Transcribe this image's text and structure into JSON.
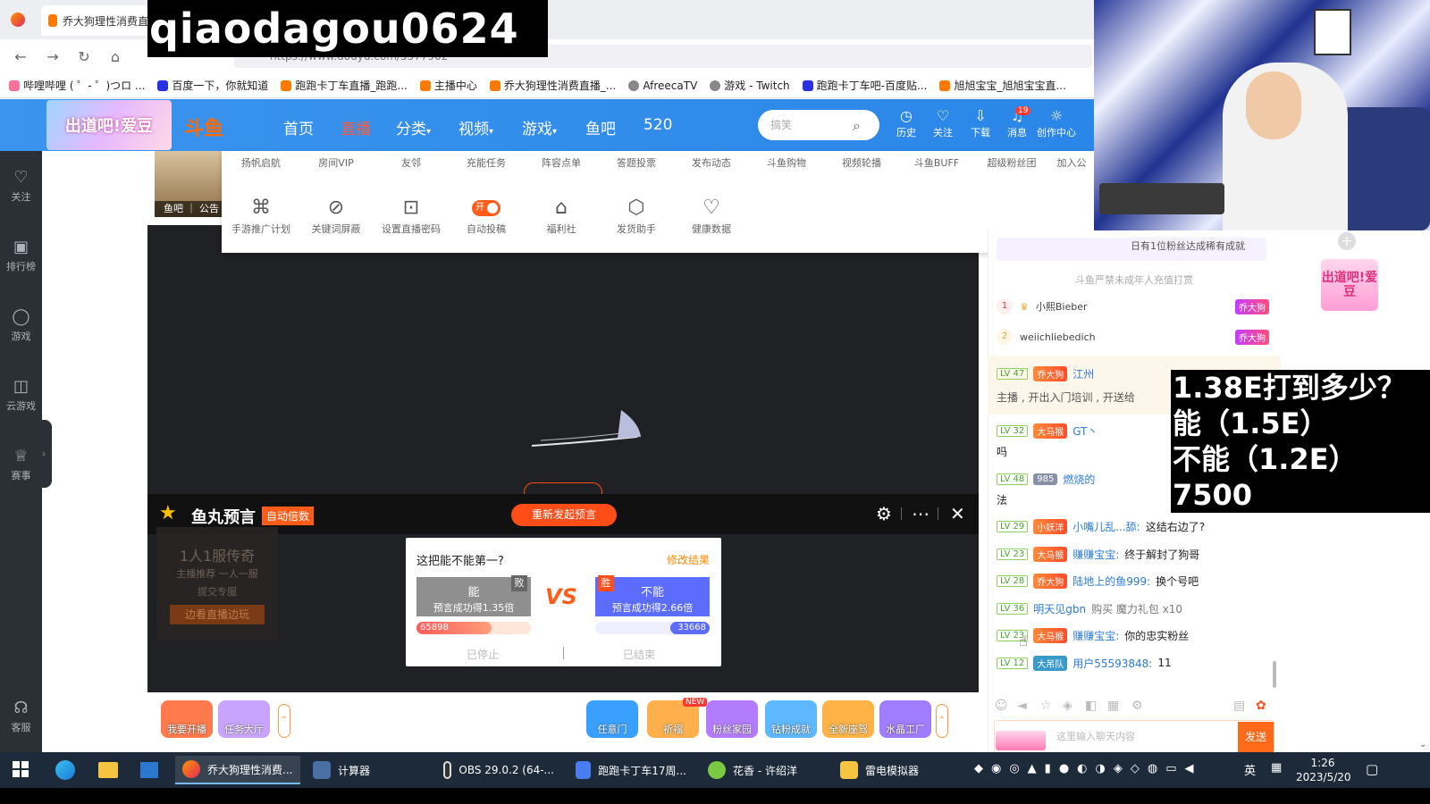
{
  "watermark": "qiaodagou0624",
  "browser": {
    "tab_title": "乔大狗理性消费直",
    "url": "https://www.douyu.com/5577902",
    "bookmarks": [
      "哔哩哔哩 ( ゜- ゜)つロ ...",
      "百度一下，你就知道",
      "跑跑卡丁车直播_跑跑...",
      "主播中心",
      "乔大狗理性消费直播_...",
      "AfreecaTV",
      "游戏 - Twitch",
      "跑跑卡丁车吧-百度贴...",
      "旭旭宝宝_旭旭宝宝直..."
    ]
  },
  "douyu_header": {
    "banner_text": "出道吧!爱豆",
    "logo_text": "斗鱼",
    "nav": [
      "首页",
      "直播",
      "分类",
      "视频",
      "游戏",
      "鱼吧",
      "520"
    ],
    "search_placeholder": "搞笑",
    "icons": [
      {
        "icon": "clock-icon",
        "label": "历史"
      },
      {
        "icon": "heart-icon",
        "label": "关注"
      },
      {
        "icon": "download-icon",
        "label": "下载"
      },
      {
        "icon": "bell-icon",
        "label": "消息",
        "badge": "19"
      },
      {
        "icon": "bulb-icon",
        "label": "创作中心"
      }
    ]
  },
  "sidebar": {
    "items": [
      "关注",
      "排行榜",
      "游戏",
      "云游戏",
      "赛事",
      "客服"
    ]
  },
  "thumb_label": "鱼吧 ｜ 公告",
  "tool_menu": {
    "row1": [
      "扬帆启航",
      "房间VIP",
      "友邻",
      "充能任务",
      "阵容点单",
      "答题投票",
      "发布动态",
      "斗鱼购物",
      "视频轮播",
      "斗鱼BUFF",
      "超级粉丝团",
      "加入公"
    ],
    "row2": [
      "手游推广计划",
      "关键词屏蔽",
      "设置直播密码",
      "自动投稿",
      "福利社",
      "发货助手",
      "健康数据"
    ],
    "toggle_label": "开"
  },
  "prediction": {
    "title": "鱼丸预言",
    "auto_tag": "自动倍数",
    "reissue_button": "重新发起预言",
    "question": "这把能不能第一?",
    "edit_link": "修改结果",
    "option_a": {
      "label": "能",
      "sub": "预言成功得1.35倍",
      "badge": "败",
      "count": "65898"
    },
    "option_b": {
      "label": "不能",
      "sub": "预言成功得2.66倍",
      "badge": "胜",
      "count": "33668"
    },
    "vs": "VS",
    "stopped": "已停止",
    "ended": "已结束"
  },
  "left_ad": {
    "title": "1人1服传奇",
    "line1": "主播推荐 一人一服",
    "line2": "提交专服",
    "button": "边看直播边玩"
  },
  "gifts": [
    {
      "label": "我要开播",
      "color": "#ff7a4d"
    },
    {
      "label": "任务大厅",
      "color": "#c9a4ff"
    },
    {
      "label": "任意门",
      "color": "#3aa0ff"
    },
    {
      "label": "祈福",
      "color": "#ffb04d"
    },
    {
      "label": "粉丝家园",
      "color": "#b37cff"
    },
    {
      "label": "钻粉成就",
      "color": "#5db8ff"
    },
    {
      "label": "全新座驾",
      "color": "#ffb347"
    },
    {
      "label": "水晶工厂",
      "color": "#a07cff"
    }
  ],
  "chat": {
    "notice": "日有1位粉丝达成稀有成就",
    "warning": "斗鱼严禁未成年人充值打赏",
    "rank": [
      {
        "num": "1",
        "name": "小熙Bieber",
        "badge": "乔大狗"
      },
      {
        "num": "2",
        "name": "weiichliebedich",
        "badge": "乔大狗"
      }
    ],
    "pinned": {
      "level": "LV 47",
      "badge": "乔大狗",
      "name": "江州",
      "text": "主播 , 开出入门培训 , 开送给"
    },
    "messages": [
      {
        "level": "LV 32",
        "badge": "大马猴",
        "name": "GT丶",
        "text": "吗"
      },
      {
        "level": "LV 48",
        "badge": "985",
        "name": "燃烧的",
        "text": "法"
      },
      {
        "level": "LV 29",
        "badge": "小妖洋",
        "name": "小嘴儿乱...舔:",
        "text": "这结右边了?"
      },
      {
        "level": "LV 23",
        "badge": "大马猴",
        "name": "赚赚宝宝:",
        "text": "终于解封了狗哥"
      },
      {
        "level": "LV 28",
        "badge": "乔大狗",
        "name": "陆地上的鱼999:",
        "text": "换个号吧"
      },
      {
        "level": "LV 36",
        "badge": "",
        "name": "明天见gbn",
        "text": "购买 魔力礼包 x10"
      },
      {
        "level": "LV 23",
        "badge": "大马猴",
        "name": "赚赚宝宝:",
        "text": "你的忠实粉丝"
      },
      {
        "level": "LV 12",
        "badge": "大吊队",
        "name": "用户55593848:",
        "text": "11"
      }
    ],
    "input_placeholder": "这里输入聊天内容",
    "send": "发送"
  },
  "right_logo": "出道吧!爱豆",
  "overlay_text": [
    "1.38E打到多少？",
    "能（1.5E）",
    "不能（1.2E）",
    "7500"
  ],
  "taskbar": {
    "items": [
      "乔大狗理性消费...",
      "计算器",
      "OBS 29.0.2 (64-...",
      "跑跑卡丁车17周...",
      "花香 - 许绍洋",
      "雷电模拟器"
    ],
    "time": "1:26",
    "date": "2023/5/20",
    "ime": "英"
  }
}
